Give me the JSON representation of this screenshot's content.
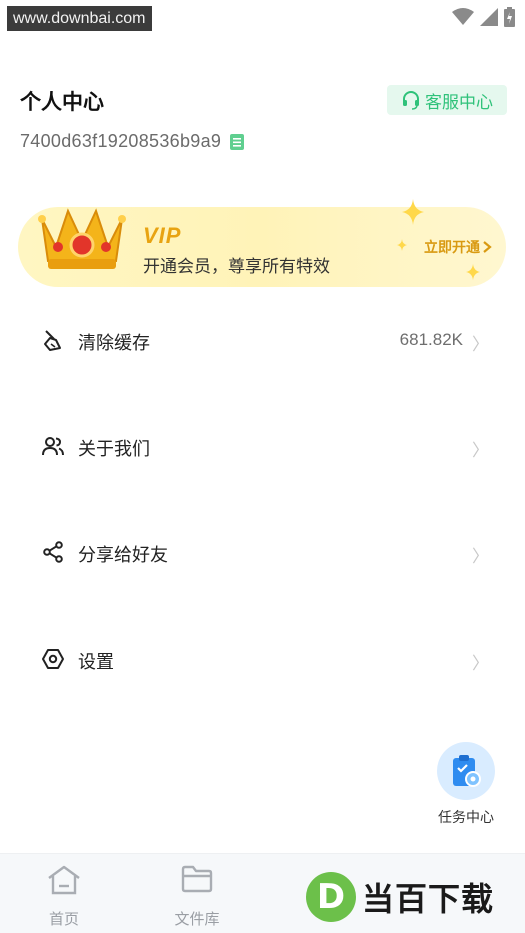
{
  "status_bar": {
    "watermark": "www.downbai.com"
  },
  "header": {
    "title": "个人中心",
    "customer_service_label": "客服中心",
    "user_id": "7400d63f19208536b9a9"
  },
  "vip": {
    "title": "VIP",
    "subtitle": "开通会员，尊享所有特效",
    "cta": "立即开通"
  },
  "menu": [
    {
      "label": "清除缓存",
      "value": "681.82K",
      "chevron": "〉",
      "icon": "broom-icon"
    },
    {
      "label": "关于我们",
      "value": "",
      "chevron": "〉",
      "icon": "users-icon"
    },
    {
      "label": "分享给好友",
      "value": "",
      "chevron": "〉",
      "icon": "share-icon"
    },
    {
      "label": "设置",
      "value": "",
      "chevron": "〉",
      "icon": "settings-icon"
    }
  ],
  "task_center": {
    "label": "任务中心"
  },
  "tabs": [
    {
      "label": "首页",
      "icon": "home-icon"
    },
    {
      "label": "文件库",
      "icon": "folder-icon"
    }
  ],
  "brand": {
    "logo_letter": "D",
    "text": "当百下载"
  },
  "colors": {
    "accent_green": "#2fc27a",
    "vip_gold": "#e8a311",
    "task_blue": "#2f8cf0"
  }
}
